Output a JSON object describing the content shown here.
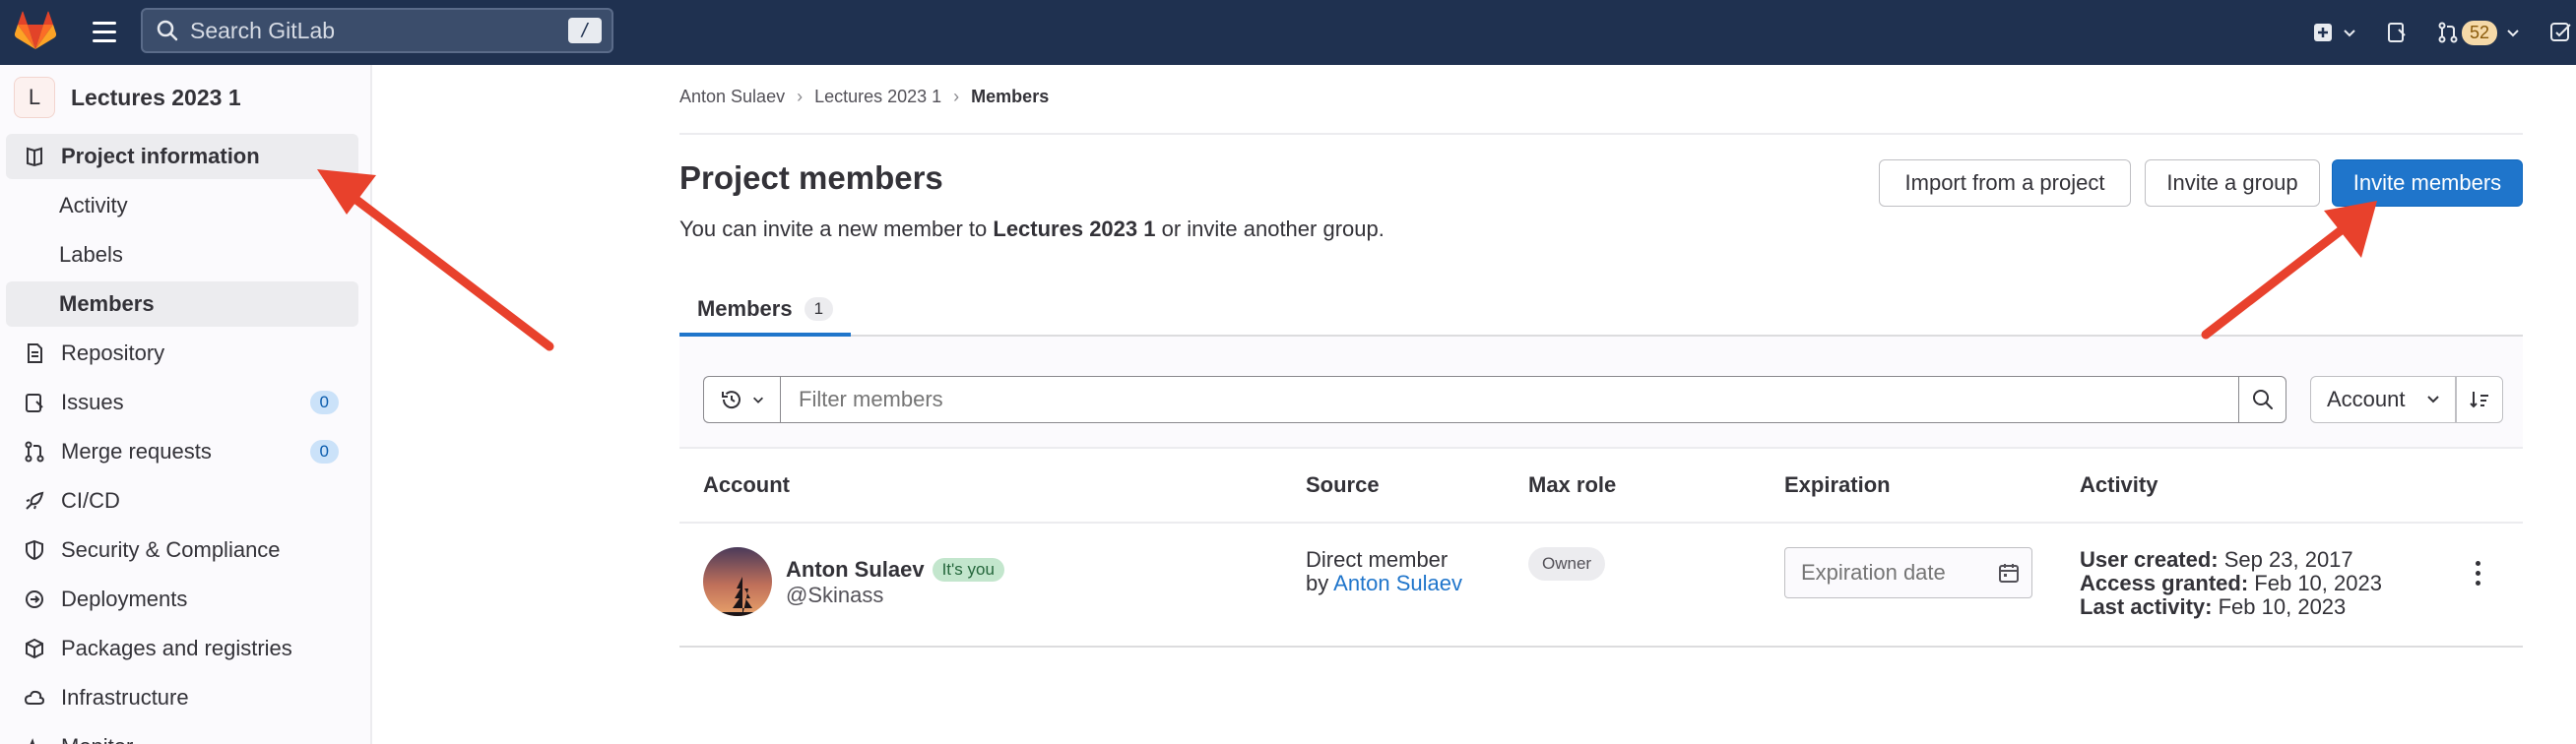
{
  "topbar": {
    "search_placeholder": "Search GitLab",
    "search_shortcut": "/",
    "merge_requests_count": "52"
  },
  "sidebar": {
    "project_initial": "L",
    "project_name": "Lectures 2023 1",
    "items": [
      {
        "label": "Project information",
        "icon": "project-information-icon"
      },
      {
        "label": "Activity"
      },
      {
        "label": "Labels"
      },
      {
        "label": "Members"
      },
      {
        "label": "Repository",
        "icon": "repository-icon"
      },
      {
        "label": "Issues",
        "icon": "issues-icon",
        "count": "0"
      },
      {
        "label": "Merge requests",
        "icon": "merge-request-icon",
        "count": "0"
      },
      {
        "label": "CI/CD",
        "icon": "rocket-icon"
      },
      {
        "label": "Security & Compliance",
        "icon": "shield-icon"
      },
      {
        "label": "Deployments",
        "icon": "deployments-icon"
      },
      {
        "label": "Packages and registries",
        "icon": "package-icon"
      },
      {
        "label": "Infrastructure",
        "icon": "cloud-icon"
      },
      {
        "label": "Monitor",
        "icon": "monitor-icon"
      }
    ]
  },
  "breadcrumb": {
    "items": [
      "Anton Sulaev",
      "Lectures 2023 1",
      "Members"
    ]
  },
  "page": {
    "title": "Project members",
    "intro_prefix": "You can invite a new member to ",
    "intro_project": "Lectures 2023 1",
    "intro_suffix": " or invite another group.",
    "import_label": "Import from a project",
    "invite_group_label": "Invite a group",
    "invite_members_label": "Invite members"
  },
  "tabs": {
    "members_label": "Members",
    "members_count": "1"
  },
  "filter": {
    "placeholder": "Filter members",
    "sort_label": "Account"
  },
  "table": {
    "headers": [
      "Account",
      "Source",
      "Max role",
      "Expiration",
      "Activity"
    ],
    "rows": [
      {
        "name": "Anton Sulaev",
        "you_badge": "It's you",
        "username": "@Skinass",
        "source_line1": "Direct member",
        "source_by": "by ",
        "source_link": "Anton Sulaev",
        "max_role": "Owner",
        "expiration_placeholder": "Expiration date",
        "activity": [
          {
            "label": "User created:",
            "value": " Sep 23, 2017"
          },
          {
            "label": "Access granted:",
            "value": " Feb 10, 2023"
          },
          {
            "label": "Last activity:",
            "value": " Feb 10, 2023"
          }
        ]
      }
    ]
  },
  "colors": {
    "topbar": "#1f3150",
    "primary": "#1f75cb",
    "annotation_arrow": "#e8412c"
  }
}
